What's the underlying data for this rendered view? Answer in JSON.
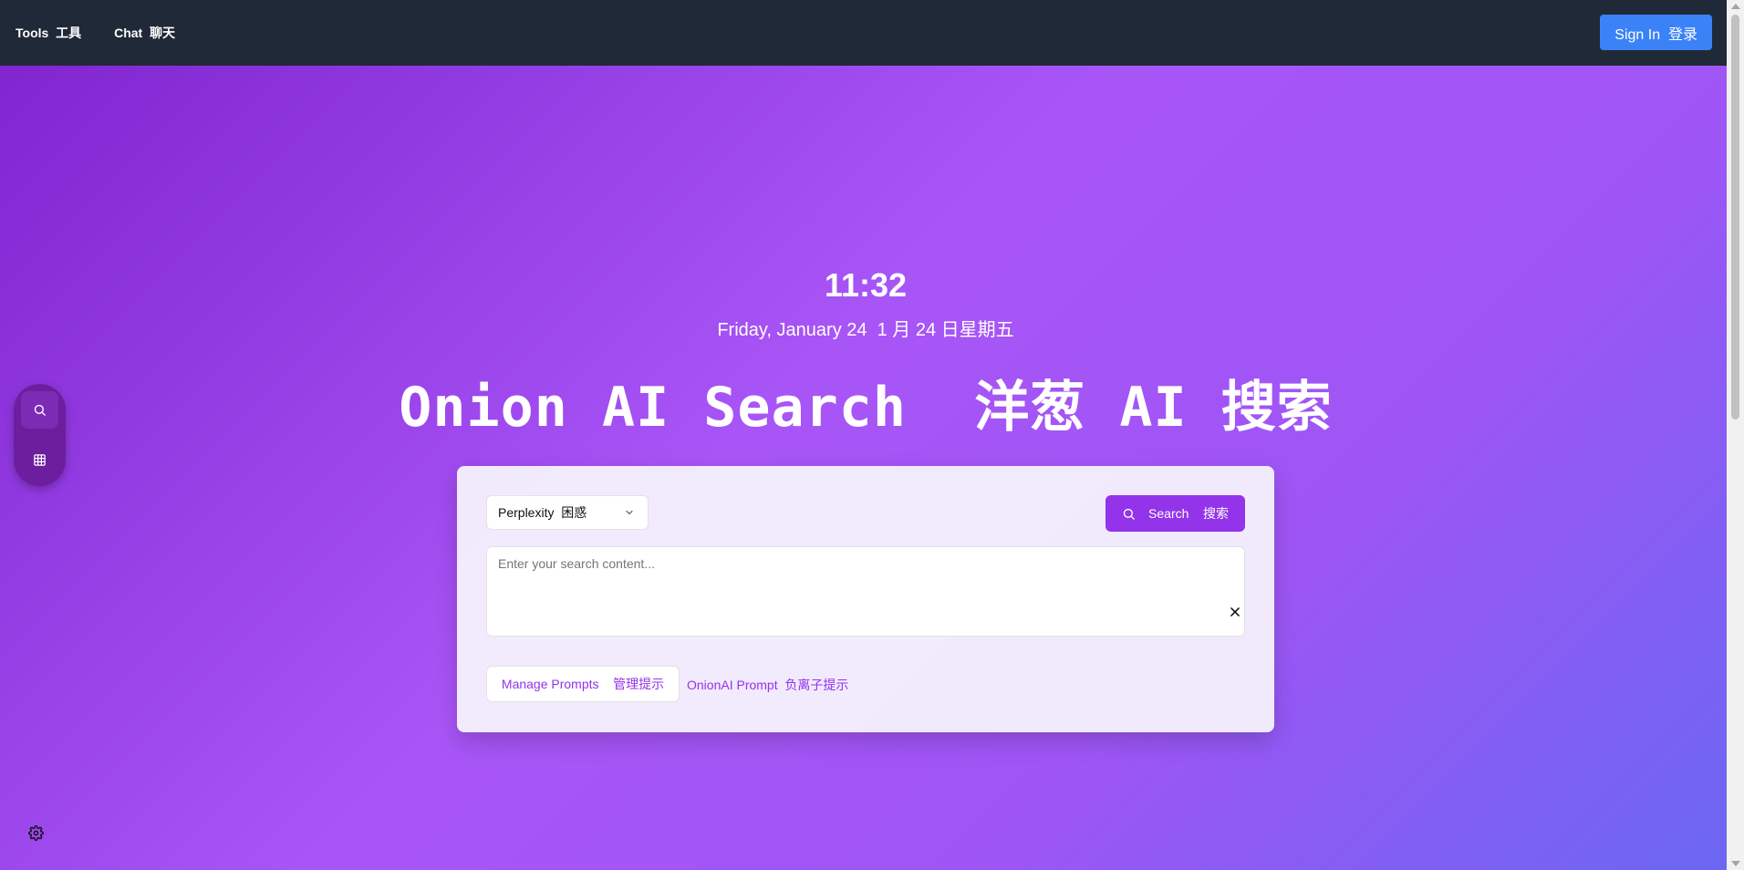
{
  "nav": {
    "tools_label": "Tools  工具",
    "chat_label": "Chat  聊天",
    "signin_label": "Sign In  登录"
  },
  "hero": {
    "time": "11:32",
    "date": "Friday, January 24  1 月 24 日星期五",
    "title": "Onion AI Search  洋葱 AI 搜索"
  },
  "search": {
    "engine_selected": "Perplexity  困惑",
    "button_label": "Search    搜索",
    "placeholder": "Enter your search content...",
    "value": ""
  },
  "prompts": {
    "manage_label": "Manage Prompts    管理提示",
    "onionai_label": "OnionAI Prompt  负离子提示"
  },
  "colors": {
    "accent": "#9333ea",
    "topbar": "#1f2937",
    "signin": "#3b82f6"
  },
  "icons": [
    "search-icon",
    "grid-icon",
    "chevron-down-icon",
    "close-icon",
    "gear-icon"
  ]
}
